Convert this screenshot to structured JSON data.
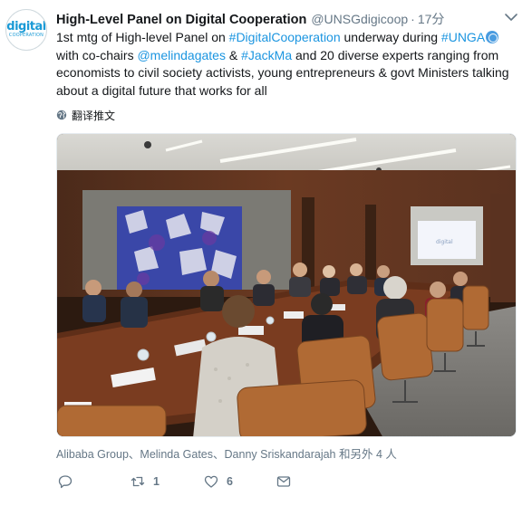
{
  "tweet": {
    "author": {
      "display_name": "High-Level Panel on Digital Cooperation",
      "handle": "@UNSGdigicoop",
      "avatar_logo_text": "digital",
      "avatar_logo_subtext": "COOPERATION"
    },
    "separator": "·",
    "time": "17分",
    "text": {
      "p1": "1st mtg of High-level Panel on ",
      "hashtag1": "#DigitalCooperation",
      "p2": " underway during ",
      "hashtag2": "#UNGA",
      "p3": " with co-chairs ",
      "mention1": "@melindagates",
      "p4": " & ",
      "hashtag3": "#JackMa",
      "p5": " and 20 diverse experts ranging from economists to civil society activists, young entrepreneurs & govt Ministers talking about a digital future that works for all"
    },
    "translate_label": "翻译推文",
    "tagged_people": "Alibaba Group、Melinda Gates、Danny Sriskandarajah 和另外 4 人",
    "actions": {
      "reply_count": "",
      "retweet_count": "1",
      "like_count": "6",
      "dm_count": ""
    },
    "colors": {
      "link": "#1b95e0",
      "secondary_text": "#657786",
      "primary_text": "#14171a",
      "brand_logo": "#1a9ad6"
    },
    "icons": [
      "chevron-down-icon",
      "globe-icon",
      "un-emoji-icon",
      "reply-icon",
      "retweet-icon",
      "like-icon",
      "direct-message-icon"
    ]
  }
}
